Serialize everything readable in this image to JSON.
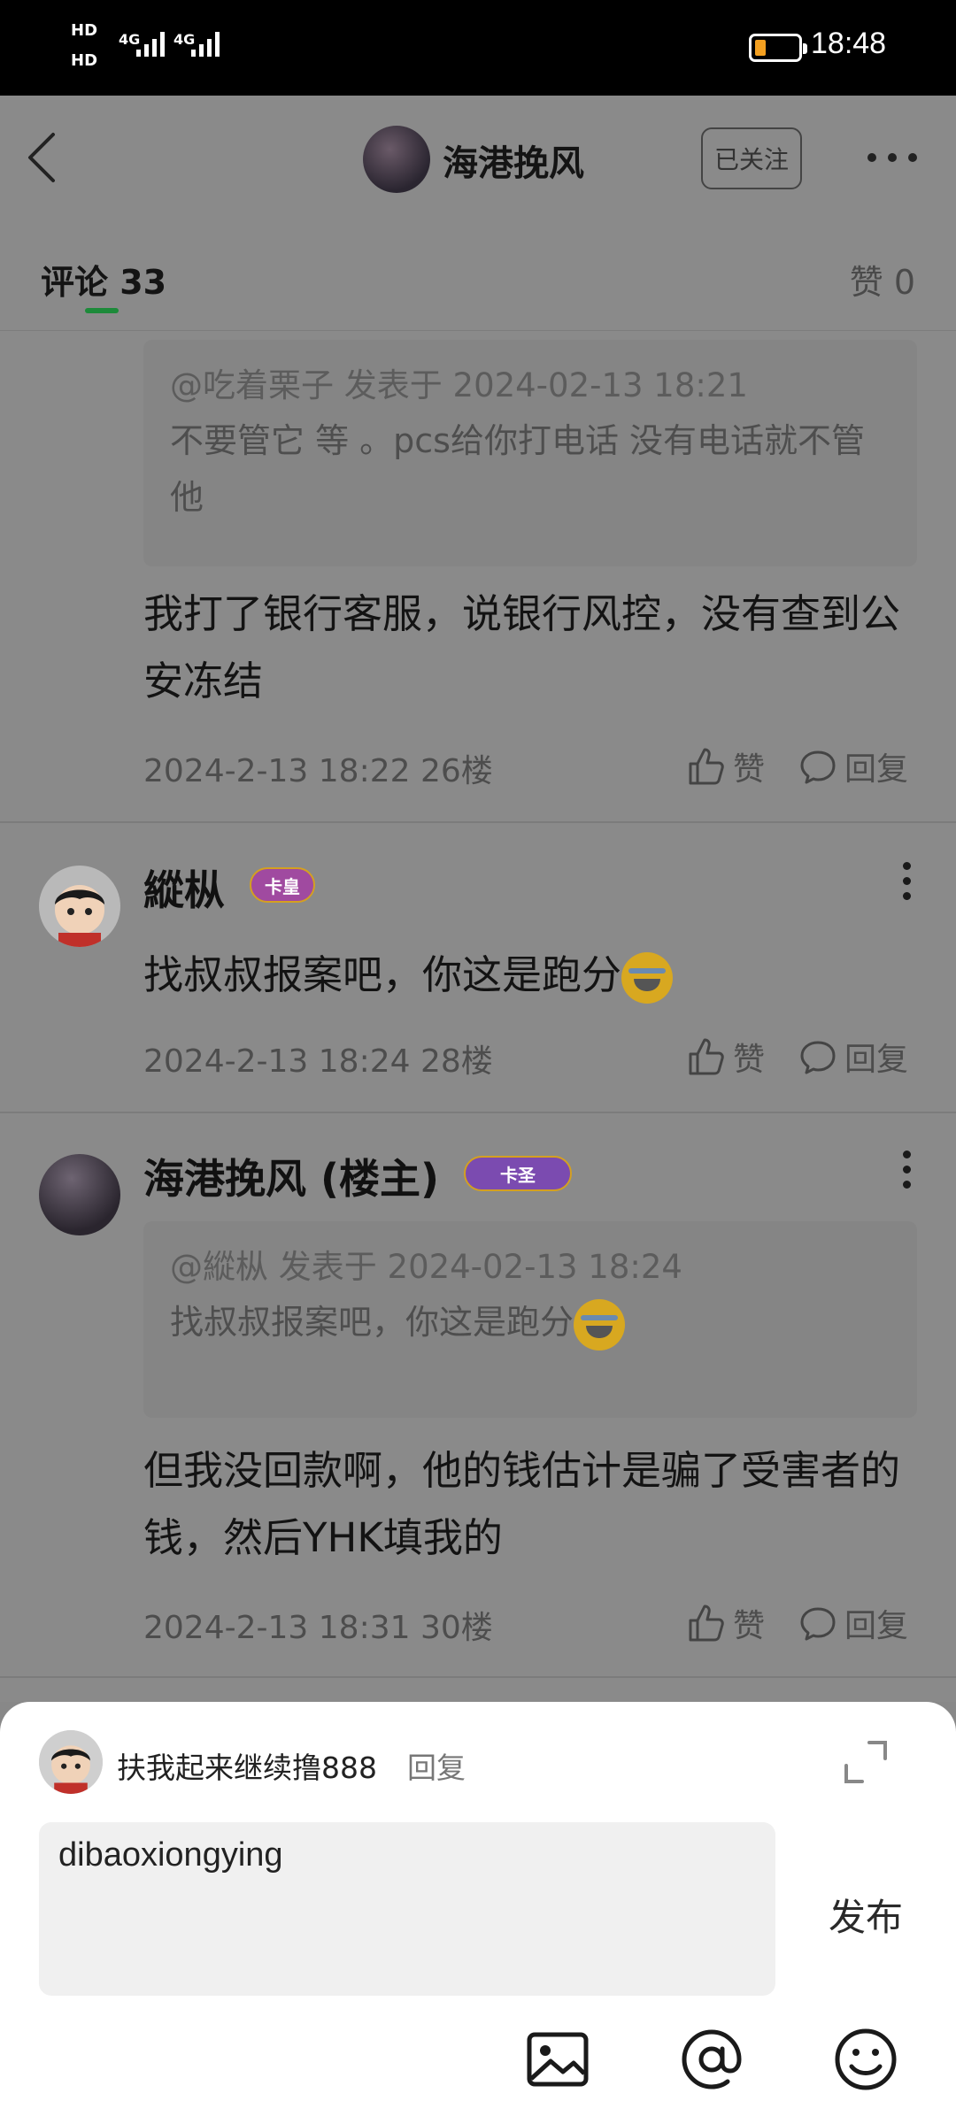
{
  "status_bar": {
    "time": "18:48",
    "sim1": "HD",
    "sim2": "HD",
    "net1": "4G",
    "net2": "4G"
  },
  "header": {
    "title": "海港挽风",
    "follow_label": "已关注"
  },
  "tabs": {
    "comments": "评论 33",
    "likes": "赞 0"
  },
  "like_label": "赞",
  "reply_label": "回复",
  "comments": [
    {
      "quote_head": "@吃着栗子 发表于 2024-02-13 18:21",
      "quote_body": "不要管它 等 。pcs给你打电话 没有电话就不管他",
      "body": "我打了银行客服，说银行风控，没有查到公安冻结",
      "meta": "2024-2-13 18:22  26楼"
    },
    {
      "username": "縱枞",
      "badge": "卡皇",
      "body": "找叔叔报案吧，你这是跑分",
      "meta": "2024-2-13 18:24  28楼"
    },
    {
      "username": "海港挽风 (楼主)",
      "badge": "卡圣",
      "quote_head": "@縱枞 发表于 2024-02-13 18:24",
      "quote_body": "找叔叔报案吧，你这是跑分",
      "body": "但我没回款啊，他的钱估计是骗了受害者的钱，然后YHK填我的",
      "meta": "2024-2-13 18:31  30楼"
    }
  ],
  "reply_sheet": {
    "reply_to_user": "扶我起来继续撸888",
    "reply_word": "回复",
    "input_value": "dibaoxiongying",
    "publish_label": "发布"
  },
  "icons": [
    "back-icon",
    "more-icon",
    "like-icon",
    "reply-icon",
    "expand-icon",
    "image-icon",
    "at-icon",
    "emoji-icon"
  ]
}
